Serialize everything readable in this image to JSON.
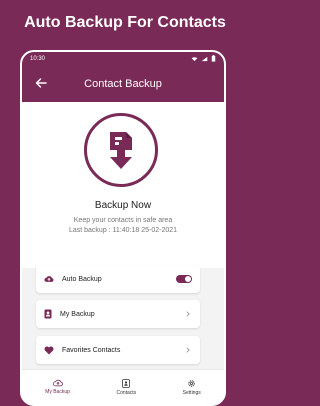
{
  "promo": {
    "title": "Auto Backup For Contacts"
  },
  "status": {
    "time": "10:30"
  },
  "appbar": {
    "title": "Contact Backup"
  },
  "hero": {
    "action_label": "Backup Now",
    "hint": "Keep your contacts in safe area",
    "last_backup": "Last backup : 11:40:18 25-02-2021"
  },
  "menu": {
    "auto_backup": {
      "label": "Auto Backup",
      "toggle_on": true
    },
    "my_backup": {
      "label": "My Backup"
    },
    "favorites": {
      "label": "Favorites Contacts"
    }
  },
  "bottom_nav": {
    "items": [
      {
        "label": "My Backup",
        "active": true
      },
      {
        "label": "Contacts",
        "active": false
      },
      {
        "label": "Settings",
        "active": false
      }
    ]
  },
  "colors": {
    "brand": "#7a2a56",
    "screen_bg": "#f3f3f3",
    "card_bg": "#ffffff"
  },
  "icons": {
    "back": "arrow-left-icon",
    "backup": "document-download-icon",
    "auto_backup": "cloud-upload-icon",
    "my_backup": "contact-card-icon",
    "favorites": "heart-icon",
    "chevron": "chevron-right-icon"
  }
}
